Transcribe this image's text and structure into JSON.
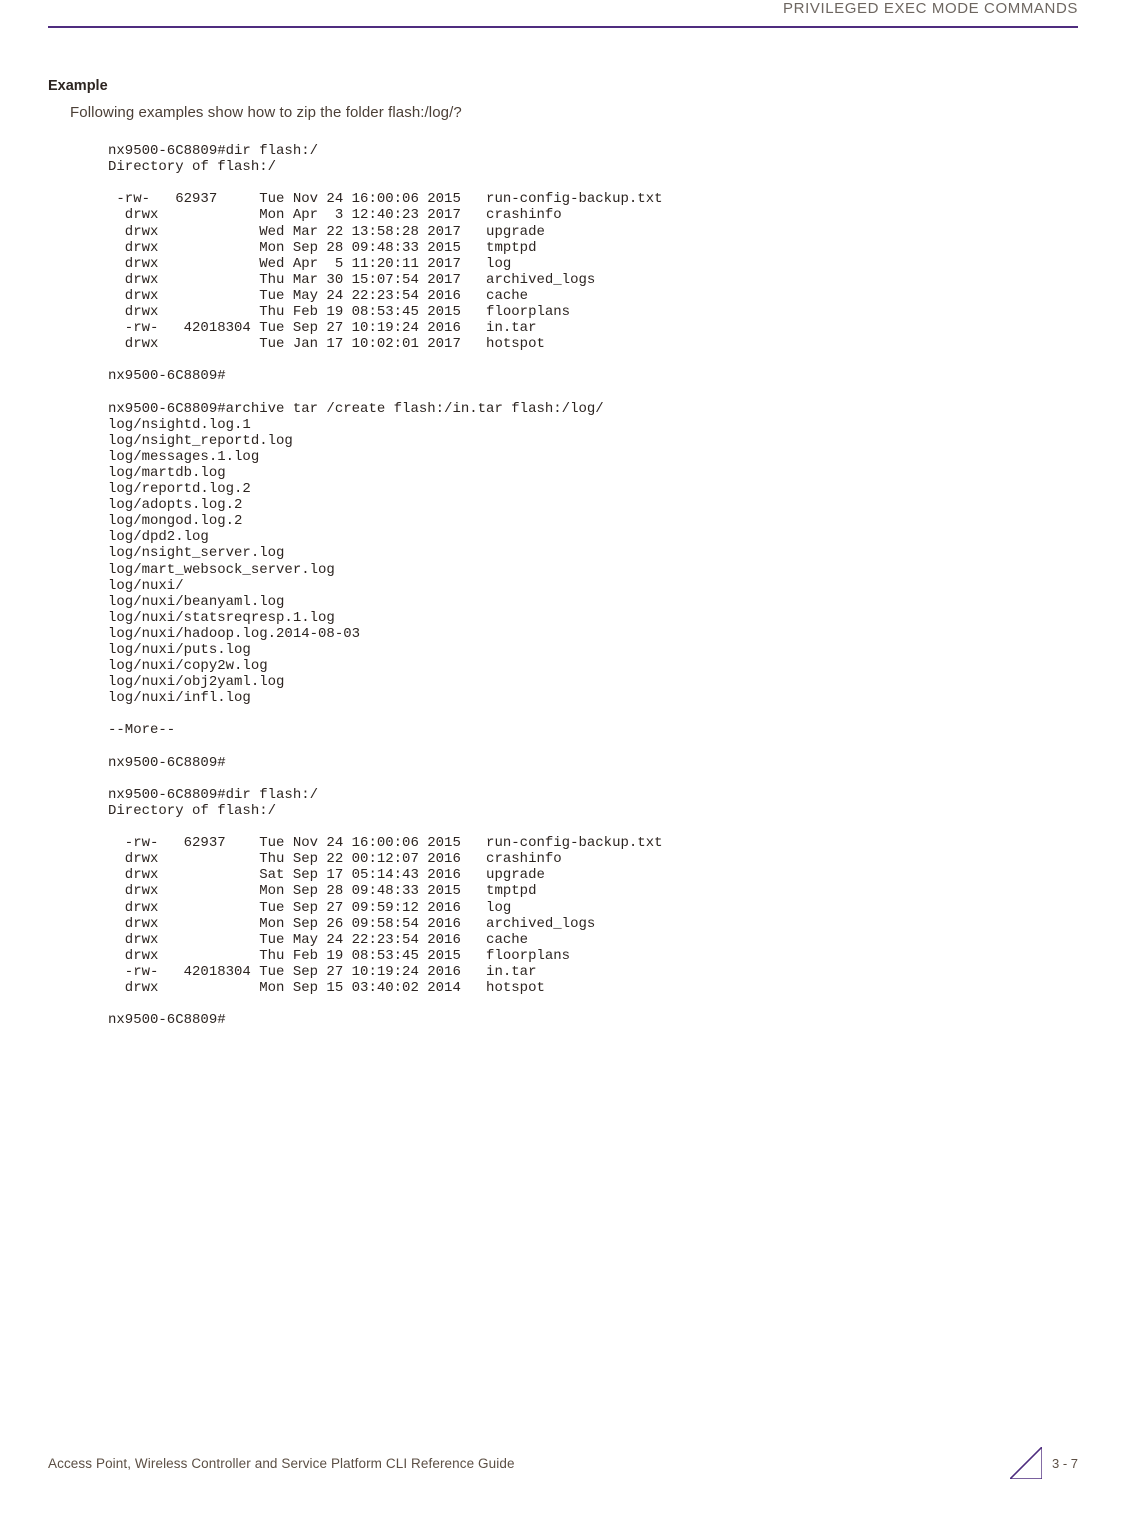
{
  "header": {
    "title": "PRIVILEGED EXEC MODE COMMANDS"
  },
  "headings": {
    "example": "Example"
  },
  "prose": {
    "lead": "Following examples show how to zip the folder flash:/log/?"
  },
  "code": {
    "line01": "nx9500-6C8809#dir flash:/",
    "line02": "Directory of flash:/",
    "line03": "",
    "line04": " -rw-   62937     Tue Nov 24 16:00:06 2015   run-config-backup.txt",
    "line05": "  drwx            Mon Apr  3 12:40:23 2017   crashinfo",
    "line06": "  drwx            Wed Mar 22 13:58:28 2017   upgrade",
    "line07": "  drwx            Mon Sep 28 09:48:33 2015   tmptpd",
    "line08": "  drwx            Wed Apr  5 11:20:11 2017   log",
    "line09": "  drwx            Thu Mar 30 15:07:54 2017   archived_logs",
    "line10": "  drwx            Tue May 24 22:23:54 2016   cache",
    "line11": "  drwx            Thu Feb 19 08:53:45 2015   floorplans",
    "line12": "  -rw-   42018304 Tue Sep 27 10:19:24 2016   in.tar",
    "line13": "  drwx            Tue Jan 17 10:02:01 2017   hotspot",
    "line14": "",
    "line15": "nx9500-6C8809#",
    "line16": "",
    "line17": "nx9500-6C8809#archive tar /create flash:/in.tar flash:/log/",
    "line18": "log/nsightd.log.1",
    "line19": "log/nsight_reportd.log",
    "line20": "log/messages.1.log",
    "line21": "log/martdb.log",
    "line22": "log/reportd.log.2",
    "line23": "log/adopts.log.2",
    "line24": "log/mongod.log.2",
    "line25": "log/dpd2.log",
    "line26": "log/nsight_server.log",
    "line27": "log/mart_websock_server.log",
    "line28": "log/nuxi/",
    "line29": "log/nuxi/beanyaml.log",
    "line30": "log/nuxi/statsreqresp.1.log",
    "line31": "log/nuxi/hadoop.log.2014-08-03",
    "line32": "log/nuxi/puts.log",
    "line33": "log/nuxi/copy2w.log",
    "line34": "log/nuxi/obj2yaml.log",
    "line35": "log/nuxi/infl.log",
    "line36": "",
    "line37": "--More--",
    "line38": "",
    "line39": "nx9500-6C8809#",
    "line40": "",
    "line41": "nx9500-6C8809#dir flash:/",
    "line42": "Directory of flash:/",
    "line43": "",
    "line44": "  -rw-   62937    Tue Nov 24 16:00:06 2015   run-config-backup.txt",
    "line45": "  drwx            Thu Sep 22 00:12:07 2016   crashinfo",
    "line46": "  drwx            Sat Sep 17 05:14:43 2016   upgrade",
    "line47": "  drwx            Mon Sep 28 09:48:33 2015   tmptpd",
    "line48": "  drwx            Tue Sep 27 09:59:12 2016   log",
    "line49": "  drwx            Mon Sep 26 09:58:54 2016   archived_logs",
    "line50": "  drwx            Tue May 24 22:23:54 2016   cache",
    "line51": "  drwx            Thu Feb 19 08:53:45 2015   floorplans",
    "line52": "  -rw-   42018304 Tue Sep 27 10:19:24 2016   in.tar",
    "line53": "  drwx            Mon Sep 15 03:40:02 2014   hotspot",
    "line54": "",
    "line55": "nx9500-6C8809#"
  },
  "footer": {
    "text": "Access Point, Wireless Controller and Service Platform CLI Reference Guide",
    "page": "3 - 7"
  }
}
